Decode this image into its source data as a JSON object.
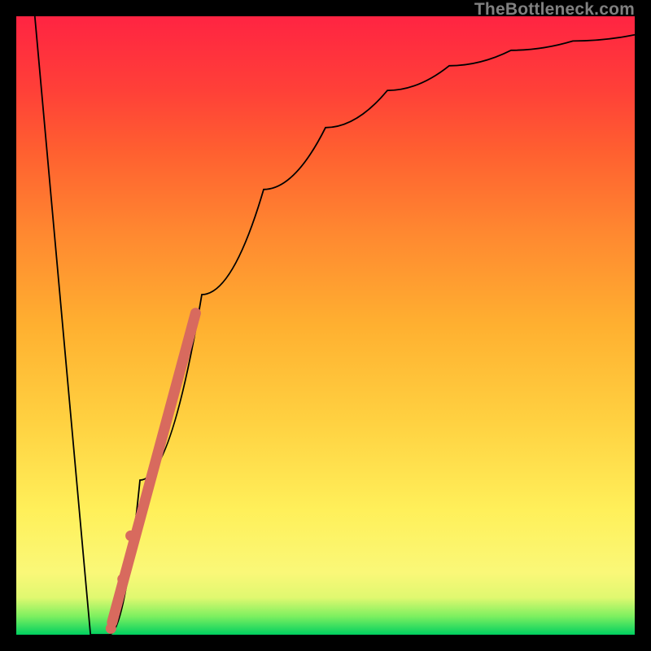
{
  "watermark": "TheBottleneck.com",
  "chart_data": {
    "type": "line",
    "title": "",
    "xlabel": "",
    "ylabel": "",
    "xlim": [
      0,
      100
    ],
    "ylim": [
      0,
      100
    ],
    "series": [
      {
        "name": "bottleneck-curve",
        "x": [
          3,
          12,
          15,
          20,
          30,
          40,
          50,
          60,
          70,
          80,
          90,
          100
        ],
        "values": [
          100,
          0,
          0,
          25,
          55,
          72,
          82,
          88,
          92,
          94.5,
          96,
          97
        ]
      }
    ],
    "marker_band": {
      "name": "highlighted-segment",
      "x": [
        15.5,
        29
      ],
      "values": [
        2,
        52
      ],
      "color": "#d86a5e"
    },
    "marker_dots": {
      "name": "dots",
      "points": [
        {
          "x": 15.3,
          "y": 1
        },
        {
          "x": 17.2,
          "y": 9
        },
        {
          "x": 18.5,
          "y": 16
        }
      ],
      "color": "#d86a5e"
    },
    "colors": {
      "curve": "#000000",
      "marker": "#d86a5e",
      "gradient_top": "#ff2442",
      "gradient_bottom": "#00d060"
    }
  }
}
